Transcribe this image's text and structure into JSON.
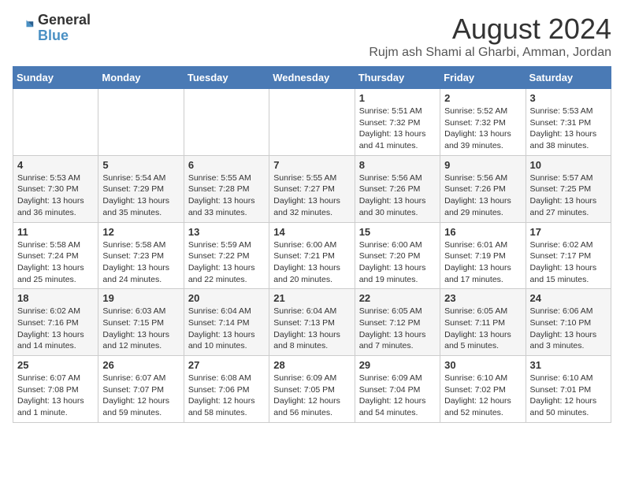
{
  "header": {
    "logo_general": "General",
    "logo_blue": "Blue",
    "month_title": "August 2024",
    "location": "Rujm ash Shami al Gharbi, Amman, Jordan"
  },
  "days_of_week": [
    "Sunday",
    "Monday",
    "Tuesday",
    "Wednesday",
    "Thursday",
    "Friday",
    "Saturday"
  ],
  "weeks": [
    [
      {
        "day": "",
        "info": ""
      },
      {
        "day": "",
        "info": ""
      },
      {
        "day": "",
        "info": ""
      },
      {
        "day": "",
        "info": ""
      },
      {
        "day": "1",
        "info": "Sunrise: 5:51 AM\nSunset: 7:32 PM\nDaylight: 13 hours\nand 41 minutes."
      },
      {
        "day": "2",
        "info": "Sunrise: 5:52 AM\nSunset: 7:32 PM\nDaylight: 13 hours\nand 39 minutes."
      },
      {
        "day": "3",
        "info": "Sunrise: 5:53 AM\nSunset: 7:31 PM\nDaylight: 13 hours\nand 38 minutes."
      }
    ],
    [
      {
        "day": "4",
        "info": "Sunrise: 5:53 AM\nSunset: 7:30 PM\nDaylight: 13 hours\nand 36 minutes."
      },
      {
        "day": "5",
        "info": "Sunrise: 5:54 AM\nSunset: 7:29 PM\nDaylight: 13 hours\nand 35 minutes."
      },
      {
        "day": "6",
        "info": "Sunrise: 5:55 AM\nSunset: 7:28 PM\nDaylight: 13 hours\nand 33 minutes."
      },
      {
        "day": "7",
        "info": "Sunrise: 5:55 AM\nSunset: 7:27 PM\nDaylight: 13 hours\nand 32 minutes."
      },
      {
        "day": "8",
        "info": "Sunrise: 5:56 AM\nSunset: 7:26 PM\nDaylight: 13 hours\nand 30 minutes."
      },
      {
        "day": "9",
        "info": "Sunrise: 5:56 AM\nSunset: 7:26 PM\nDaylight: 13 hours\nand 29 minutes."
      },
      {
        "day": "10",
        "info": "Sunrise: 5:57 AM\nSunset: 7:25 PM\nDaylight: 13 hours\nand 27 minutes."
      }
    ],
    [
      {
        "day": "11",
        "info": "Sunrise: 5:58 AM\nSunset: 7:24 PM\nDaylight: 13 hours\nand 25 minutes."
      },
      {
        "day": "12",
        "info": "Sunrise: 5:58 AM\nSunset: 7:23 PM\nDaylight: 13 hours\nand 24 minutes."
      },
      {
        "day": "13",
        "info": "Sunrise: 5:59 AM\nSunset: 7:22 PM\nDaylight: 13 hours\nand 22 minutes."
      },
      {
        "day": "14",
        "info": "Sunrise: 6:00 AM\nSunset: 7:21 PM\nDaylight: 13 hours\nand 20 minutes."
      },
      {
        "day": "15",
        "info": "Sunrise: 6:00 AM\nSunset: 7:20 PM\nDaylight: 13 hours\nand 19 minutes."
      },
      {
        "day": "16",
        "info": "Sunrise: 6:01 AM\nSunset: 7:19 PM\nDaylight: 13 hours\nand 17 minutes."
      },
      {
        "day": "17",
        "info": "Sunrise: 6:02 AM\nSunset: 7:17 PM\nDaylight: 13 hours\nand 15 minutes."
      }
    ],
    [
      {
        "day": "18",
        "info": "Sunrise: 6:02 AM\nSunset: 7:16 PM\nDaylight: 13 hours\nand 14 minutes."
      },
      {
        "day": "19",
        "info": "Sunrise: 6:03 AM\nSunset: 7:15 PM\nDaylight: 13 hours\nand 12 minutes."
      },
      {
        "day": "20",
        "info": "Sunrise: 6:04 AM\nSunset: 7:14 PM\nDaylight: 13 hours\nand 10 minutes."
      },
      {
        "day": "21",
        "info": "Sunrise: 6:04 AM\nSunset: 7:13 PM\nDaylight: 13 hours\nand 8 minutes."
      },
      {
        "day": "22",
        "info": "Sunrise: 6:05 AM\nSunset: 7:12 PM\nDaylight: 13 hours\nand 7 minutes."
      },
      {
        "day": "23",
        "info": "Sunrise: 6:05 AM\nSunset: 7:11 PM\nDaylight: 13 hours\nand 5 minutes."
      },
      {
        "day": "24",
        "info": "Sunrise: 6:06 AM\nSunset: 7:10 PM\nDaylight: 13 hours\nand 3 minutes."
      }
    ],
    [
      {
        "day": "25",
        "info": "Sunrise: 6:07 AM\nSunset: 7:08 PM\nDaylight: 13 hours\nand 1 minute."
      },
      {
        "day": "26",
        "info": "Sunrise: 6:07 AM\nSunset: 7:07 PM\nDaylight: 12 hours\nand 59 minutes."
      },
      {
        "day": "27",
        "info": "Sunrise: 6:08 AM\nSunset: 7:06 PM\nDaylight: 12 hours\nand 58 minutes."
      },
      {
        "day": "28",
        "info": "Sunrise: 6:09 AM\nSunset: 7:05 PM\nDaylight: 12 hours\nand 56 minutes."
      },
      {
        "day": "29",
        "info": "Sunrise: 6:09 AM\nSunset: 7:04 PM\nDaylight: 12 hours\nand 54 minutes."
      },
      {
        "day": "30",
        "info": "Sunrise: 6:10 AM\nSunset: 7:02 PM\nDaylight: 12 hours\nand 52 minutes."
      },
      {
        "day": "31",
        "info": "Sunrise: 6:10 AM\nSunset: 7:01 PM\nDaylight: 12 hours\nand 50 minutes."
      }
    ]
  ]
}
